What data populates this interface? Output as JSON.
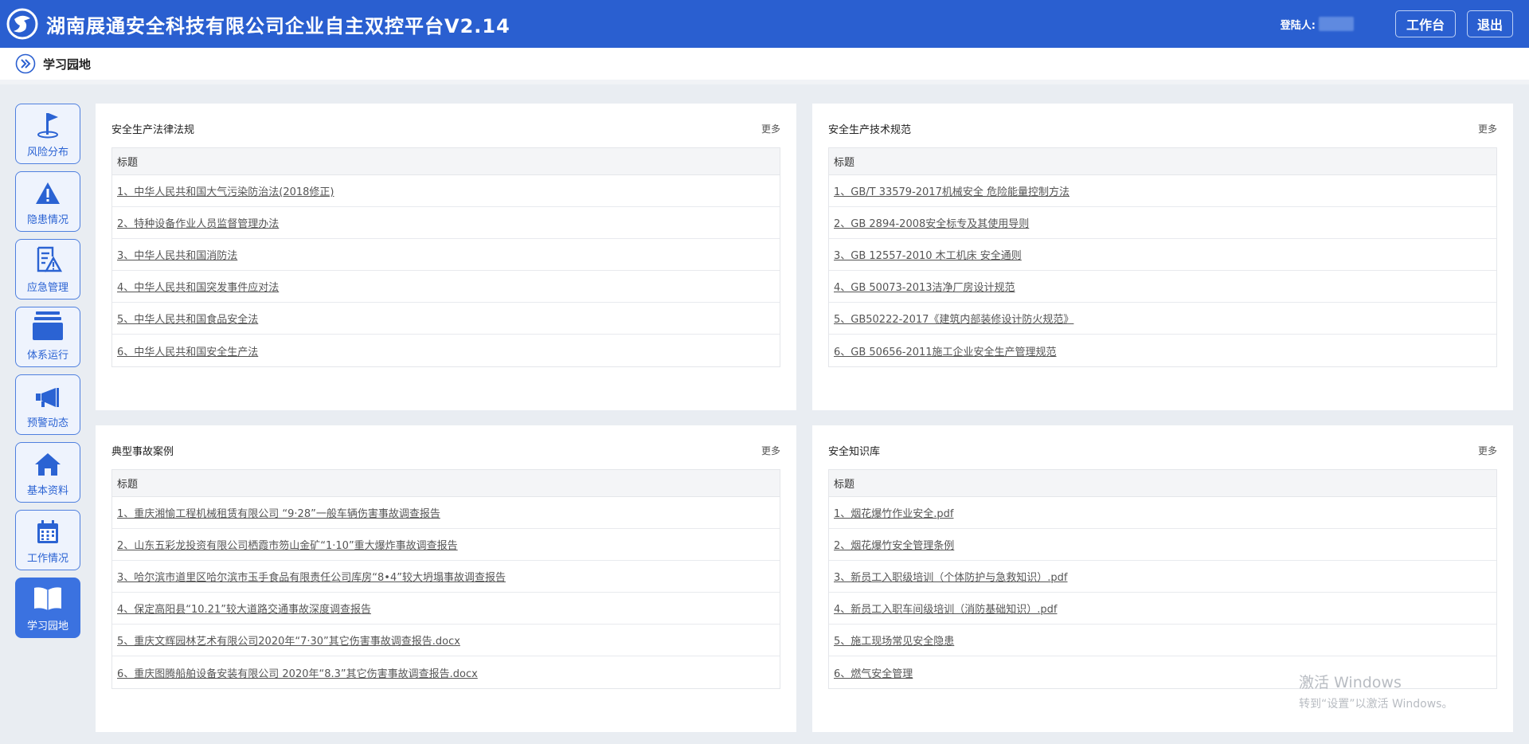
{
  "header": {
    "title": "湖南展通安全科技有限公司企业自主双控平台V2.14",
    "login_label": "登陆人:",
    "workbench_label": "工作台",
    "logout_label": "退出",
    "bg_color": "#2a5fd0"
  },
  "breadcrumb": {
    "text": "学习园地",
    "icon": "double-chevron-right-icon"
  },
  "sidebar": {
    "items": [
      {
        "label": "风险分布",
        "icon": "flag-icon"
      },
      {
        "label": "隐患情况",
        "icon": "warning-icon"
      },
      {
        "label": "应急管理",
        "icon": "document-warning-icon"
      },
      {
        "label": "体系运行",
        "icon": "stack-icon"
      },
      {
        "label": "预警动态",
        "icon": "megaphone-icon"
      },
      {
        "label": "基本资料",
        "icon": "home-icon"
      },
      {
        "label": "工作情况",
        "icon": "calendar-icon"
      },
      {
        "label": "学习园地",
        "icon": "book-icon",
        "active": true
      }
    ]
  },
  "panels": [
    {
      "title": "安全生产法律法规",
      "more": "更多",
      "column": "标题",
      "rows": [
        "1、中华人民共和国大气污染防治法(2018修正)",
        "2、特种设备作业人员监督管理办法",
        "3、中华人民共和国消防法",
        "4、中华人民共和国突发事件应对法",
        "5、中华人民共和国食品安全法",
        "6、中华人民共和国安全生产法"
      ]
    },
    {
      "title": "安全生产技术规范",
      "more": "更多",
      "column": "标题",
      "rows": [
        "1、GB/T 33579-2017机械安全 危险能量控制方法",
        "2、GB 2894-2008安全标专及其使用导则",
        "3、GB 12557-2010 木工机床 安全通则",
        "4、GB 50073-2013洁净厂房设计规范",
        "5、GB50222-2017《建筑内部装修设计防火规范》",
        "6、GB 50656-2011施工企业安全生产管理规范"
      ]
    },
    {
      "title": "典型事故案例",
      "more": "更多",
      "column": "标题",
      "rows": [
        "1、重庆湘愉工程机械租赁有限公司 “9·28”一般车辆伤害事故调查报告",
        "2、山东五彩龙投资有限公司栖霞市笏山金矿“1·10”重大爆炸事故调查报告",
        "3、哈尔滨市道里区哈尔滨市玉手食品有限责任公司库房“8•4”较大坍塌事故调查报告",
        "4、保定高阳县“10.21”较大道路交通事故深度调查报告",
        "5、重庆文辉园林艺术有限公司2020年“7·30”其它伤害事故调查报告.docx",
        "6、重庆图腾船舶设备安装有限公司 2020年“8.3”其它伤害事故调查报告.docx"
      ]
    },
    {
      "title": "安全知识库",
      "more": "更多",
      "column": "标题",
      "rows": [
        "1、烟花爆竹作业安全.pdf",
        "2、烟花爆竹安全管理条例",
        "3、新员工入职级培训（个体防护与急救知识）.pdf",
        "4、新员工入职车间级培训（消防基础知识）.pdf",
        "5、施工现场常见安全隐患",
        "6、燃气安全管理"
      ]
    }
  ],
  "watermark": {
    "line1": "激活 Windows",
    "line2": "转到“设置”以激活 Windows。"
  }
}
